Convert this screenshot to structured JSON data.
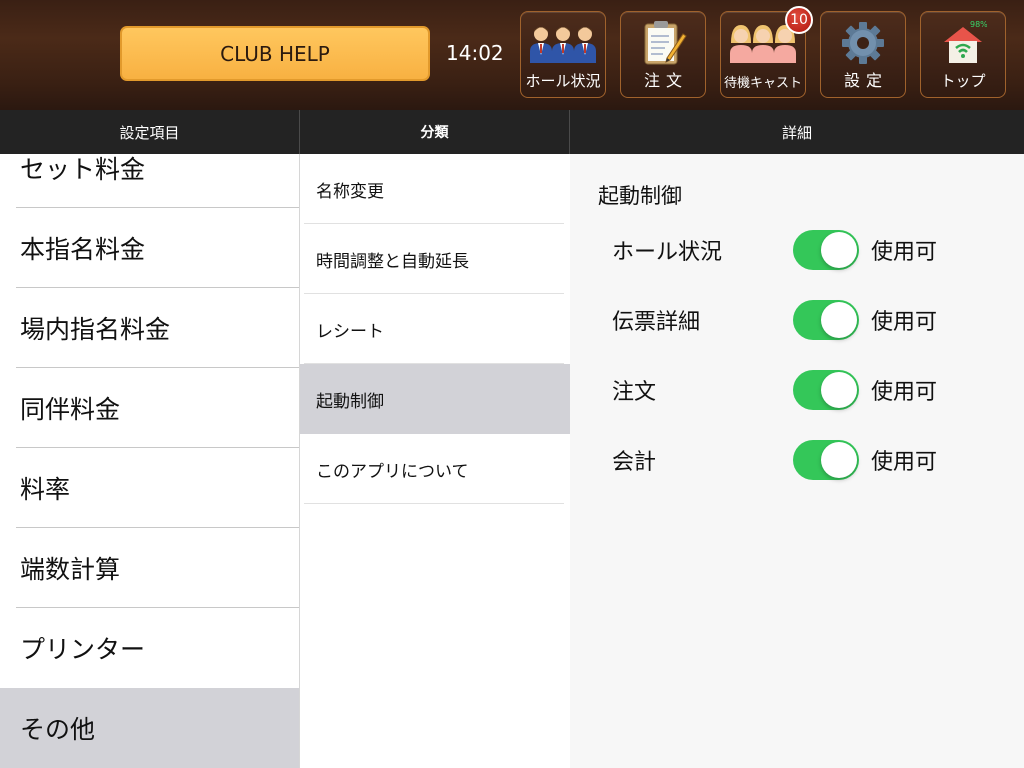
{
  "header": {
    "club_button": "CLUB HELP",
    "clock": "14:02",
    "nav": {
      "hall": {
        "label": "ホール状況",
        "icon": "hall-staff-icon"
      },
      "order": {
        "label": "注文",
        "icon": "order-clipboard-icon"
      },
      "waiting_cast": {
        "label": "待機キャスト",
        "icon": "waiting-cast-icon",
        "badge": "10"
      },
      "settings": {
        "label": "設定",
        "icon": "gear-icon"
      },
      "top": {
        "label": "トップ",
        "icon": "home-wifi-icon",
        "signal_text": "98%"
      }
    }
  },
  "columns": {
    "settings_items_header": "設定項目",
    "category_header": "分類",
    "detail_header": "詳細"
  },
  "settings_items": [
    {
      "label": "セット料金"
    },
    {
      "label": "本指名料金"
    },
    {
      "label": "場内指名料金"
    },
    {
      "label": "同伴料金"
    },
    {
      "label": "料率"
    },
    {
      "label": "端数計算"
    },
    {
      "label": "プリンター"
    },
    {
      "label": "その他",
      "selected": true
    }
  ],
  "categories": [
    {
      "label": "名称変更"
    },
    {
      "label": "時間調整と自動延長"
    },
    {
      "label": "レシート"
    },
    {
      "label": "起動制御",
      "selected": true
    },
    {
      "label": "このアプリについて"
    }
  ],
  "detail": {
    "section_title": "起動制御",
    "rows": [
      {
        "name": "ホール状況",
        "enabled": true,
        "state_label": "使用可"
      },
      {
        "name": "伝票詳細",
        "enabled": true,
        "state_label": "使用可"
      },
      {
        "name": "注文",
        "enabled": true,
        "state_label": "使用可"
      },
      {
        "name": "会計",
        "enabled": true,
        "state_label": "使用可"
      }
    ]
  },
  "colors": {
    "topbar_brown": "#3a2014",
    "club_button_orange": "#f8b142",
    "header_dark": "#232323",
    "selected_gray": "#d2d2d7",
    "toggle_green": "#34c759",
    "badge_red": "#c0221a"
  }
}
